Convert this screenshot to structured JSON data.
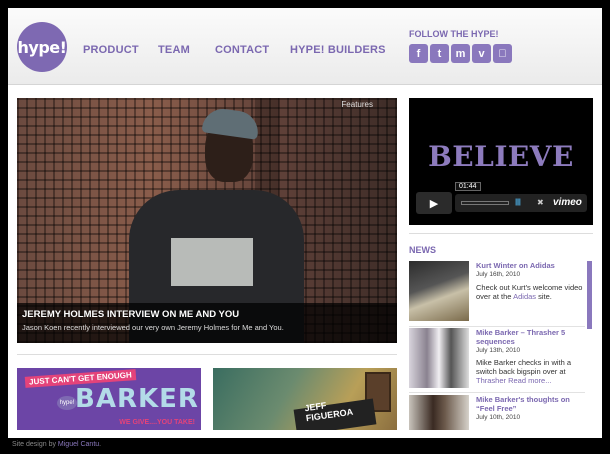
{
  "header": {
    "logo_text": "hype!",
    "nav": [
      "PRODUCT",
      "TEAM",
      "CONTACT",
      "HYPE! BUILDERS"
    ],
    "follow_label": "FOLLOW THE HYPE!",
    "social": [
      {
        "icon": "facebook-icon",
        "glyph": "f"
      },
      {
        "icon": "twitter-icon",
        "glyph": "t"
      },
      {
        "icon": "myspace-icon",
        "glyph": "m"
      },
      {
        "icon": "vimeo-icon",
        "glyph": "v"
      },
      {
        "icon": "apple-icon",
        "glyph": ""
      }
    ]
  },
  "feature": {
    "label": "Features",
    "title": "JEREMY HOLMES INTERVIEW ON ME AND YOU",
    "subtitle": "Jason Koen recently interviewed our very own Jeremy Holmes for Me and You."
  },
  "banners": {
    "barker": {
      "top": "JUST CAN'T GET ENOUGH",
      "name": "BARKER",
      "badge": "hype!",
      "bottom": "WE GIVE....YOU TAKE!"
    },
    "jeff": {
      "name_line1": "JEFF",
      "name_line2": "FIGUEROA"
    }
  },
  "video": {
    "title_text": "BELIEVE",
    "time": "01:44",
    "play_glyph": "▶",
    "volume": "||||||",
    "fullscreen_glyph": "✖",
    "brand": "vimeo"
  },
  "news": {
    "heading": "NEWS",
    "items": [
      {
        "title": "Kurt Winter on Adidas",
        "date": "July 16th, 2010",
        "text": "Check out Kurt's welcome video over at the ",
        "link": "Adidas",
        "suffix": " site."
      },
      {
        "title": "Mike Barker – Thrasher 5 sequences",
        "date": "July 13th, 2010",
        "text": "Mike Barker checks in with a switch back bigspin over at ",
        "link": "Thrasher Read more...",
        "suffix": ""
      },
      {
        "title": "Mike Barker's thoughts on “Feel Free”",
        "date": "July 10th, 2010",
        "text": "",
        "link": "",
        "suffix": ""
      }
    ]
  },
  "footer": {
    "text": "Site design by ",
    "link": "Miguel Cantu",
    "suffix": "."
  },
  "colors": {
    "accent": "#7b68b0",
    "background": "#000000",
    "panel": "#ffffff"
  }
}
